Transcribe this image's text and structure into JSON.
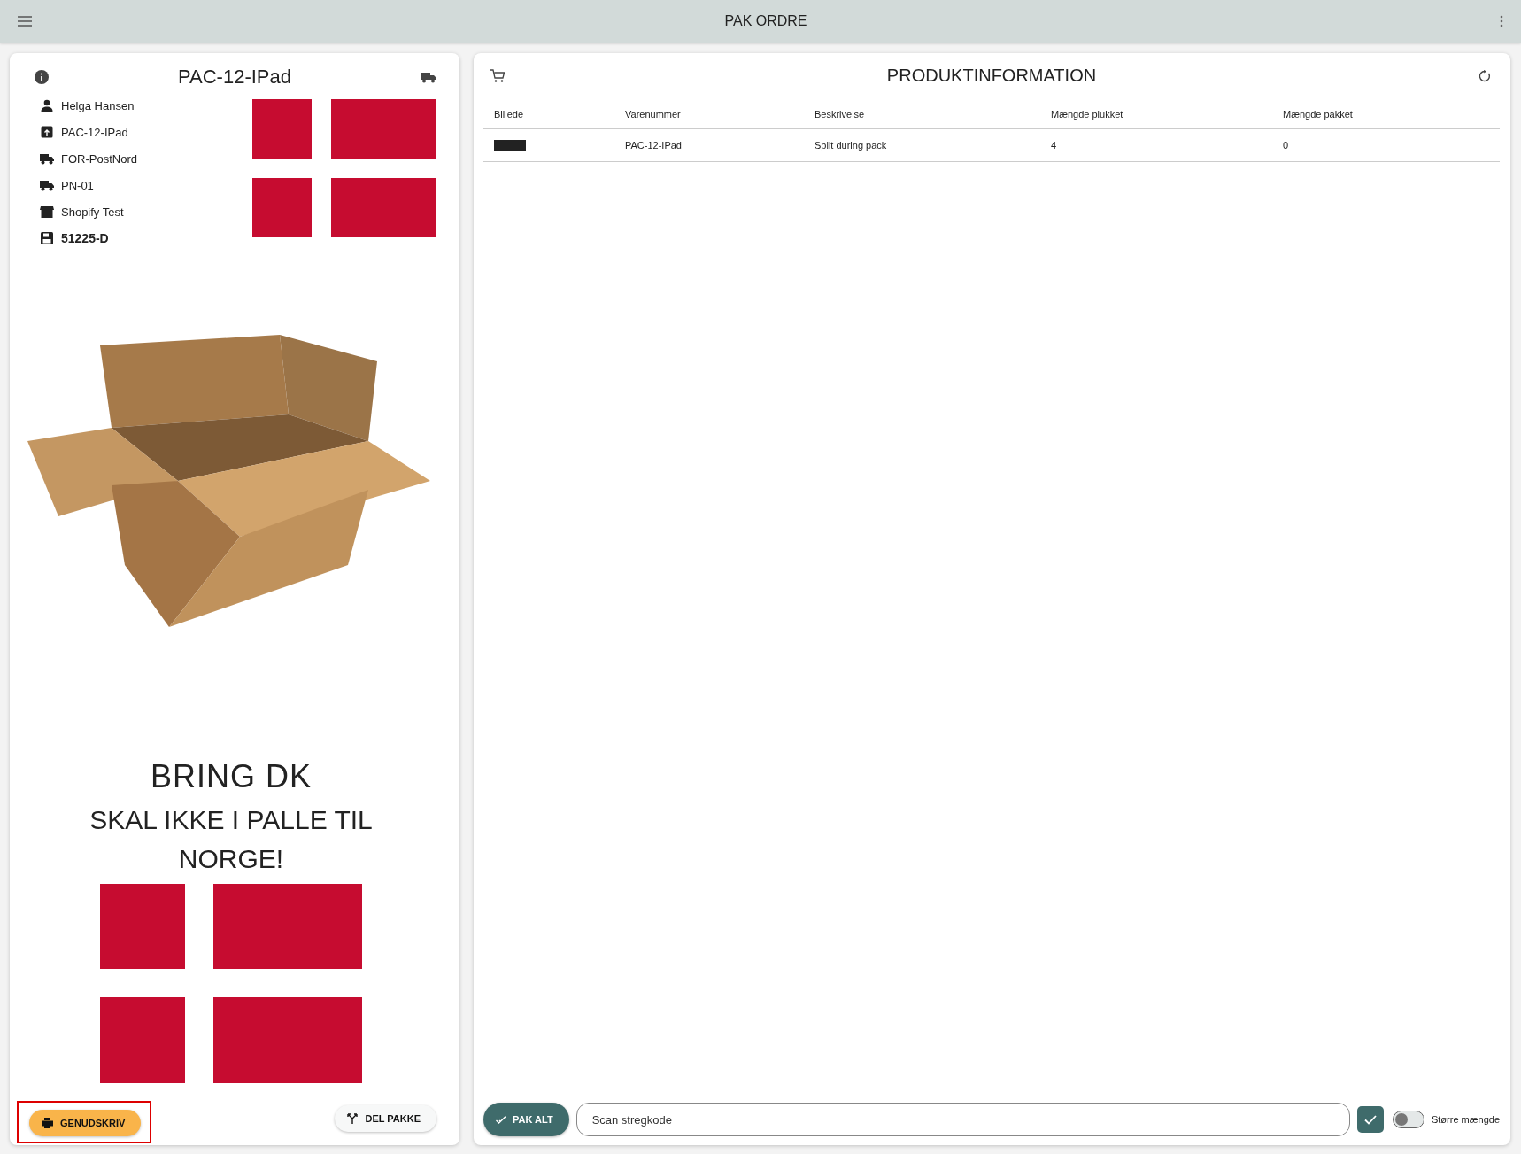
{
  "app_bar": {
    "title": "PAK ORDRE"
  },
  "order_panel": {
    "title": "PAC-12-IPad",
    "details": [
      {
        "kind": "person",
        "text": "Helga Hansen",
        "bold": false
      },
      {
        "kind": "package",
        "text": "PAC-12-IPad",
        "bold": false
      },
      {
        "kind": "truck",
        "text": "FOR-PostNord",
        "bold": false
      },
      {
        "kind": "truck",
        "text": "PN-01",
        "bold": false
      },
      {
        "kind": "store",
        "text": "Shopify Test",
        "bold": false
      },
      {
        "kind": "save",
        "text": "51225-D",
        "bold": true
      }
    ],
    "carrier_message": {
      "title": "BRING DK",
      "subtitle": "SKAL IKKE I PALLE TIL NORGE!"
    },
    "buttons": [
      {
        "kind": "reprint",
        "label": "GENUDSKRIV",
        "highlighted": true
      },
      {
        "kind": "split",
        "label": "DEL PAKKE",
        "highlighted": false
      }
    ]
  },
  "product_panel": {
    "title": "PRODUKTINFORMATION",
    "table": {
      "columns": [
        "Billede",
        "Varenummer",
        "Beskrivelse",
        "Mængde plukket",
        "Mængde pakket"
      ],
      "rows": [
        {
          "cells": [
            "",
            "PAC-12-IPad",
            "Split during pack",
            "4",
            "0"
          ]
        }
      ]
    },
    "pack_all_button": {
      "label": "PAK ALT"
    },
    "scan_field": {
      "placeholder": "Scan stregkode"
    },
    "larger_quantity_toggle": {
      "label": "Større mængde",
      "on": false
    }
  }
}
